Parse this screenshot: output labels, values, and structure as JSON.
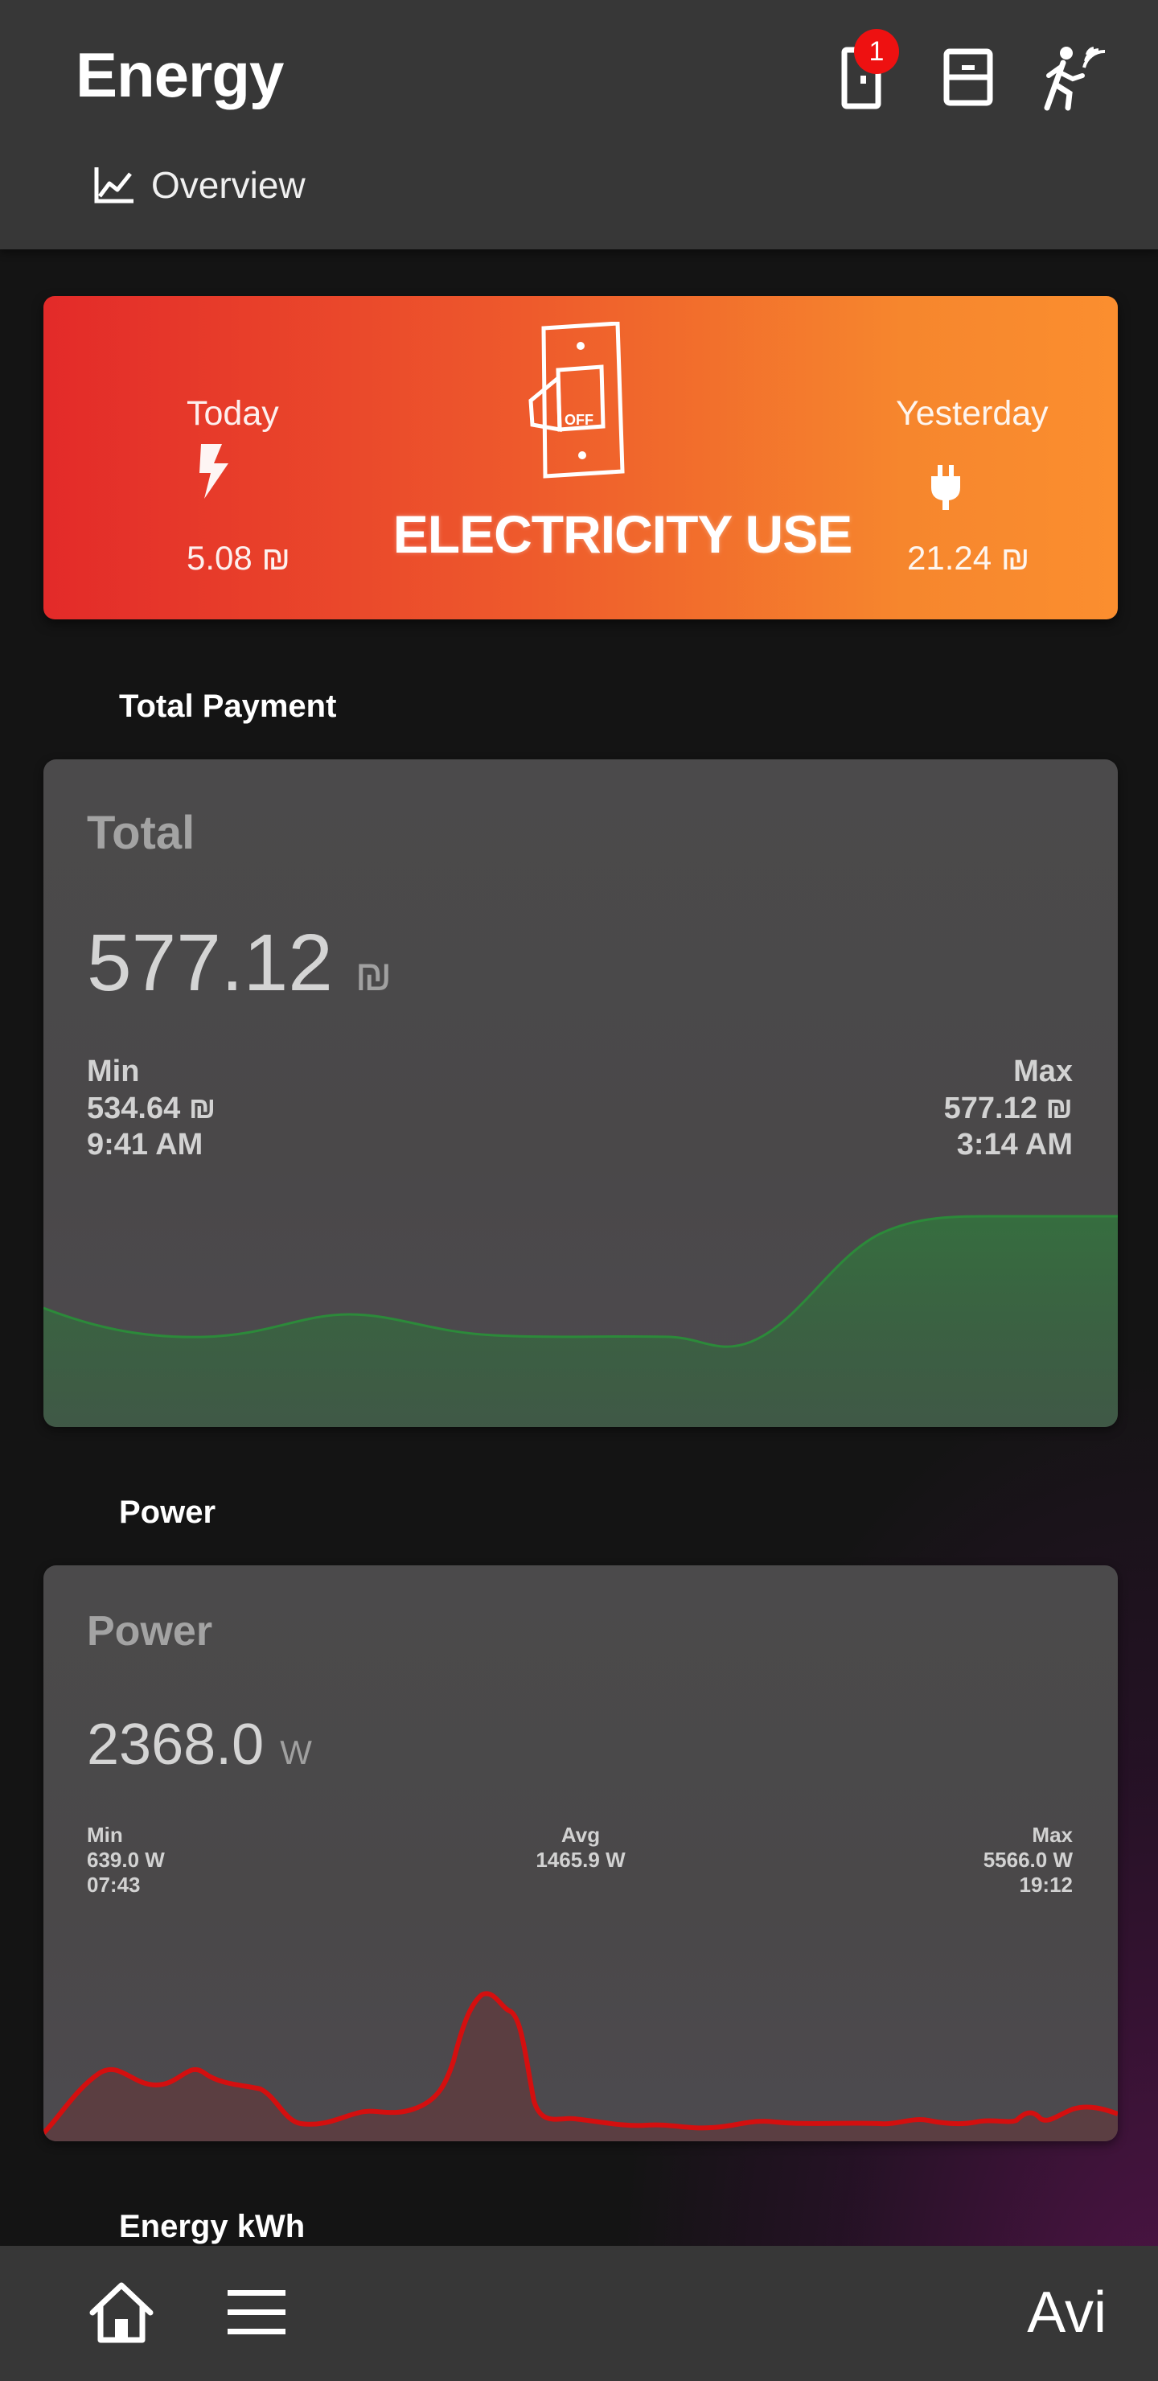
{
  "header": {
    "title": "Energy",
    "notification_count": "1",
    "tab_label": "Overview",
    "icons": [
      "door-icon",
      "cabinet-icon",
      "motion-sensor-icon",
      "chart-line-icon"
    ]
  },
  "banner": {
    "today_label": "Today",
    "today_value": "5.08 ₪",
    "yesterday_label": "Yesterday",
    "yesterday_value": "21.24 ₪",
    "headline": "ELECTRICITY USE",
    "switch_text": "OFF",
    "colors": {
      "start": "#e32a29",
      "end": "#fb8e2f"
    }
  },
  "sections": {
    "total_payment": "Total Payment",
    "power": "Power",
    "energy_kwh": "Energy kWh"
  },
  "total_card": {
    "name": "Total",
    "value": "577.12",
    "unit": "₪",
    "min_label": "Min",
    "min_value": "534.64 ₪",
    "min_time": "9:41 AM",
    "max_label": "Max",
    "max_value": "577.12 ₪",
    "max_time": "3:14 AM",
    "line_color": "#2c8a3a"
  },
  "power_card": {
    "name": "Power",
    "value": "2368.0",
    "unit": "W",
    "min_label": "Min",
    "min_value": "639.0 W",
    "min_time": "07:43",
    "avg_label": "Avg",
    "avg_value": "1465.9 W",
    "max_label": "Max",
    "max_value": "5566.0 W",
    "max_time": "19:12",
    "line_color": "#d40f0f"
  },
  "bottom_bar": {
    "user": "Avi",
    "icons": [
      "home-icon",
      "menu-icon"
    ]
  }
}
